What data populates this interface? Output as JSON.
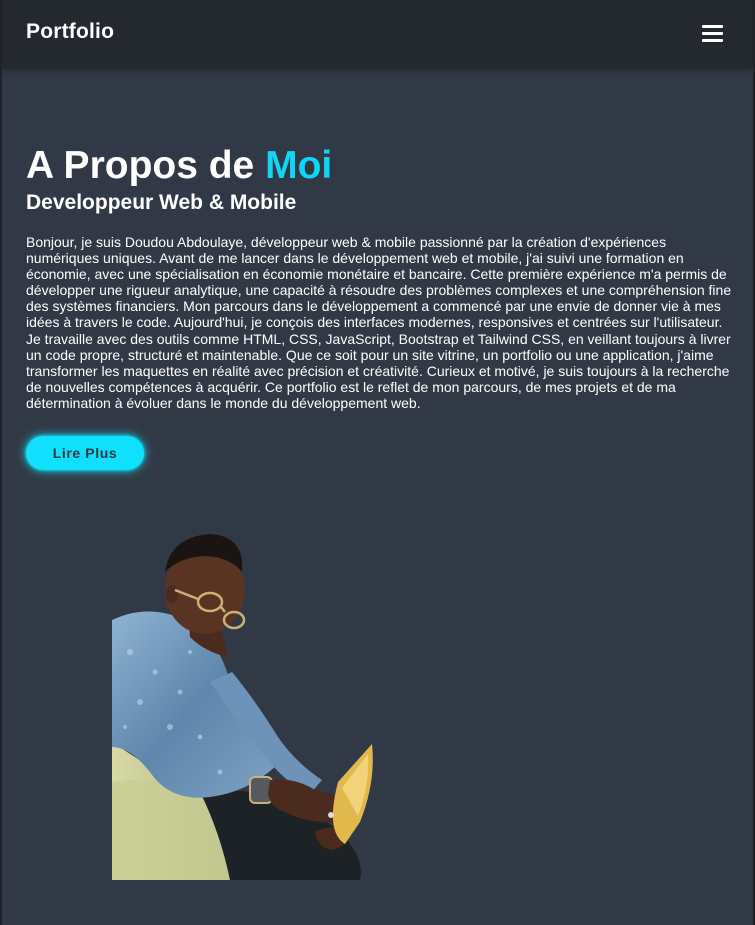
{
  "navbar": {
    "brand": "Portfolio",
    "menu_icon": "hamburger-menu-icon"
  },
  "about": {
    "heading_prefix": "A Propos de ",
    "heading_accent": "Moi",
    "subtitle": "Developpeur Web & Mobile",
    "bio": "Bonjour, je suis Doudou Abdoulaye, développeur web & mobile passionné par la création d'expériences numériques uniques. Avant de me lancer dans le développement web et mobile, j'ai suivi une formation en économie, avec une spécialisation en économie monétaire et bancaire. Cette première expérience m'a permis de développer une rigueur analytique, une capacité à résoudre des problèmes complexes et une compréhension fine des systèmes financiers. Mon parcours dans le développement a commencé par une envie de donner vie à mes idées à travers le code. Aujourd'hui, je conçois des interfaces modernes, responsives et centrées sur l'utilisateur. Je travaille avec des outils comme HTML, CSS, JavaScript, Bootstrap et Tailwind CSS, en veillant toujours à livrer un code propre, structuré et maintenable. Que ce soit pour un site vitrine, un portfolio ou une application, j'aime transformer les maquettes en réalité avec précision et créativité. Curieux et motivé, je suis toujours à la recherche de nouvelles compétences à acquérir. Ce portfolio est le reflet de mon parcours, de mes projets et de ma détermination à évoluer dans le monde du développement web.",
    "cta_label": "Lire Plus",
    "photo_alt": "Photo de profil"
  },
  "colors": {
    "background": "#323946",
    "navbar": "#242930",
    "accent": "#10e0fb",
    "text": "#ffffff"
  }
}
